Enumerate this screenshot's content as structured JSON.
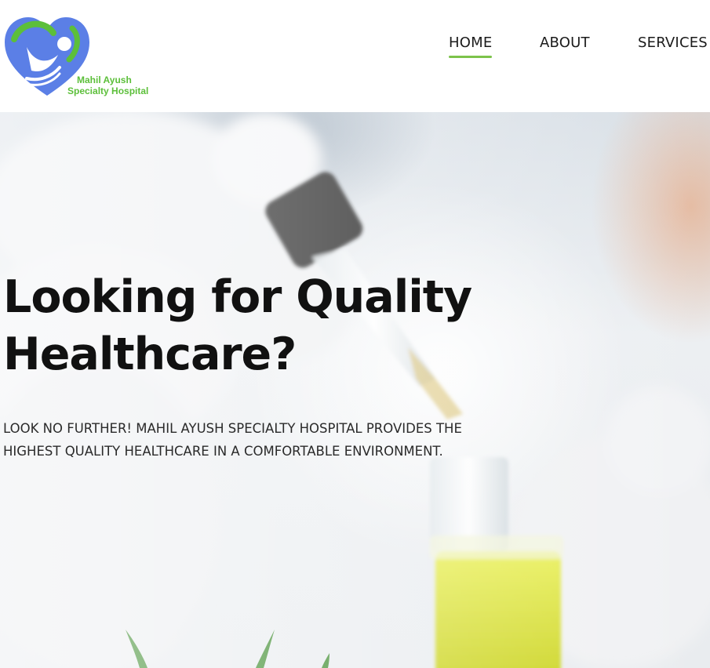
{
  "header": {
    "logo": {
      "line1": "Mahil Ayush",
      "line2": "Specialty Hospital",
      "icon": "heart-person-logo",
      "colors": {
        "blue": "#5b7fe6",
        "green": "#5cbf3a"
      }
    },
    "nav": {
      "items": [
        {
          "label": "HOME",
          "active": true
        },
        {
          "label": "ABOUT",
          "active": false
        },
        {
          "label": "SERVICES",
          "active": false
        }
      ],
      "active_underline_color": "#7cc34a"
    }
  },
  "hero": {
    "title": "Looking for Quality Healthcare?",
    "subtitle": "LOOK NO FURTHER! MAHIL AYUSH SPECIALTY HOSPITAL PROVIDES THE HIGHEST QUALITY HEALTHCARE IN A COMFORTABLE ENVIRONMENT.",
    "background_image": "gloved hands with dropper and yellow test tube"
  }
}
